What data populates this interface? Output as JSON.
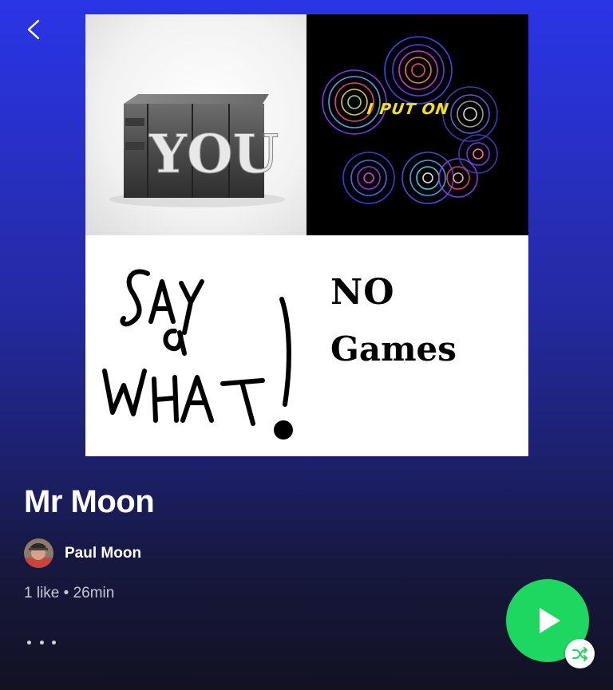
{
  "playlist": {
    "title": "Mr Moon",
    "owner": "Paul Moon",
    "likes": "1 like",
    "separator": "•",
    "duration": "26min",
    "meta_text": "1 like • 26min"
  },
  "cover": {
    "tile_1_text": "YOU",
    "tile_2_text": "I PUT ON",
    "tile_3_text": "SAY WHAT!",
    "tile_4_line1": "NO",
    "tile_4_line2": "Games"
  },
  "icons": {
    "back": "chevron-left-icon",
    "more": "more-dots-icon",
    "play": "play-icon",
    "shuffle": "shuffle-icon"
  },
  "colors": {
    "accent": "#1ed760",
    "background_top": "#2a35e6",
    "background_bottom": "#121222",
    "text_secondary": "#c6c6d6",
    "on_text": "#f2e21c"
  }
}
